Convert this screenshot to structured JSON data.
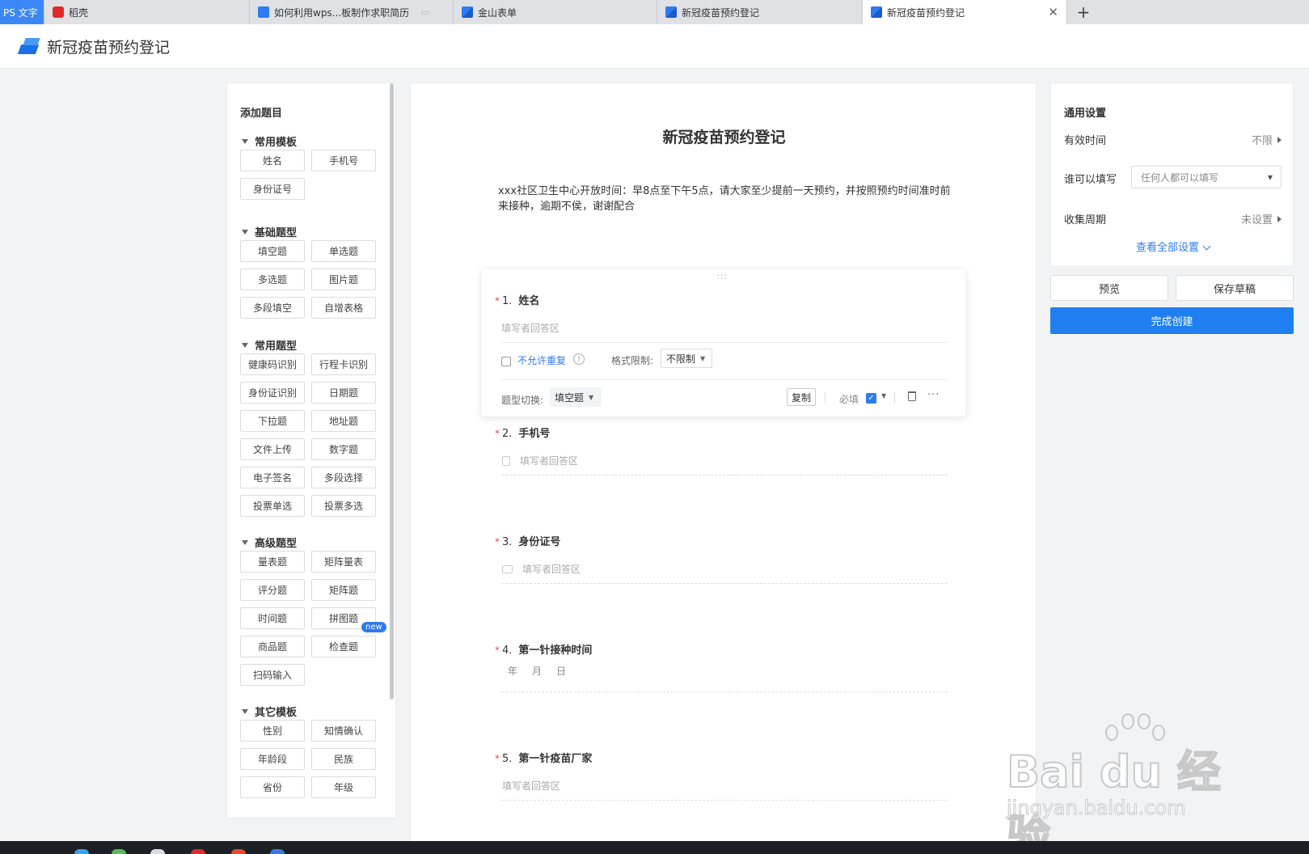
{
  "tabs": [
    {
      "label": "PS 文字"
    },
    {
      "label": "稻壳"
    },
    {
      "label": "如何利用wps...板制作求职简历"
    },
    {
      "label": "金山表单"
    },
    {
      "label": "新冠疫苗预约登记"
    },
    {
      "label": "新冠疫苗预约登记",
      "active": true
    }
  ],
  "header": {
    "title": "新冠疫苗预约登记"
  },
  "left_panel": {
    "title": "添加题目",
    "sections": [
      {
        "name": "常用模板",
        "items": [
          "姓名",
          "手机号",
          "身份证号"
        ]
      },
      {
        "name": "基础题型",
        "items": [
          "填空题",
          "单选题",
          "多选题",
          "图片题",
          "多段填空",
          "自增表格"
        ]
      },
      {
        "name": "常用题型",
        "items": [
          "健康码识别",
          "行程卡识别",
          "身份证识别",
          "日期题",
          "下拉题",
          "地址题",
          "文件上传",
          "数字题",
          "电子签名",
          "多段选择",
          "投票单选",
          "投票多选"
        ]
      },
      {
        "name": "高级题型",
        "items": [
          "量表题",
          "矩阵量表",
          "评分题",
          "矩阵题",
          "时间题",
          "拼图题",
          "商品题",
          "检查题",
          "扫码输入"
        ]
      },
      {
        "name": "其它模板",
        "items": [
          "性别",
          "知情确认",
          "年龄段",
          "民族",
          "省份",
          "年级"
        ]
      }
    ],
    "new_badge": "new"
  },
  "form": {
    "title": "新冠疫苗预约登记",
    "description": "xxx社区卫生中心开放时间：早8点至下午5点，请大家至少提前一天预约，并按照预约时间准时前来接种，逾期不侯，谢谢配合",
    "questions": [
      {
        "num": "1.",
        "label": "姓名",
        "placeholder": "填写者回答区"
      },
      {
        "num": "2.",
        "label": "手机号",
        "placeholder": "填写者回答区"
      },
      {
        "num": "3.",
        "label": "身份证号",
        "placeholder": "填写者回答区"
      },
      {
        "num": "4.",
        "label": "第一针接种时间",
        "date_parts": [
          "年",
          "月",
          "日"
        ]
      },
      {
        "num": "5.",
        "label": "第一针疫苗厂家",
        "placeholder": "填写者回答区"
      }
    ],
    "active": {
      "no_repeat": "不允许重复",
      "format_label": "格式限制:",
      "format_value": "不限制",
      "type_label": "题型切换:",
      "type_value": "填空题",
      "copy": "复制",
      "required": "必填",
      "more": "···",
      "drag": ":::"
    }
  },
  "right_panel": {
    "title": "通用设置",
    "valid_time_label": "有效时间",
    "valid_time_value": "不限",
    "who_label": "谁可以填写",
    "who_value": "任何人都可以填写",
    "cycle_label": "收集周期",
    "cycle_value": "未设置",
    "view_all": "查看全部设置",
    "preview": "预览",
    "save_draft": "保存草稿",
    "finish": "完成创建"
  },
  "watermark": {
    "main": "Bai du 经验",
    "sub": "jingyan.baidu.com"
  },
  "colors": {
    "accent": "#1f7ff0",
    "required_star": "#e34d4d"
  }
}
